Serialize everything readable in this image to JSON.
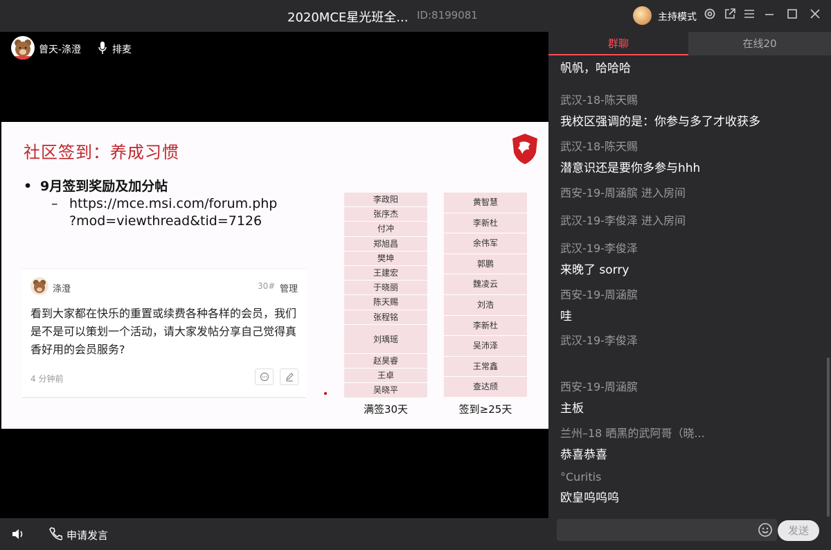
{
  "titlebar": {
    "title": "2020MCE星光班全...",
    "room_id": "ID:8199081",
    "host_mode": "主持模式"
  },
  "video": {
    "user_name": "曾天-涤澄",
    "queue_label": "排麦"
  },
  "slide": {
    "title": "社区签到：养成习惯",
    "bullet": "9月签到奖励及加分帖",
    "link_line1": "https://mce.msi.com/forum.php",
    "link_line2": "?mod=viewthread&tid=7126",
    "post": {
      "name": "涤澄",
      "floor": "30#",
      "admin": "管理",
      "body": "看到大家都在快乐的重置或续费各种各样的会员，我们是不是可以策划一个活动，请大家发帖分享自己觉得真香好用的会员服务?",
      "time": "4 分钟前"
    },
    "table1": {
      "label": "满签30天",
      "names": [
        "李政阳",
        "张序杰",
        "付冲",
        "郑旭昌",
        "樊坤",
        "王建宏",
        "于晓丽",
        "陈天赐",
        "张程铭",
        "刘瑀瑶",
        "赵昊睿",
        "王卓",
        "吴晓平"
      ]
    },
    "table2": {
      "label": "签到≥25天",
      "names": [
        "黄智慧",
        "李新杜",
        "余伟军",
        "郭鹏",
        "魏凌云",
        "刘浩",
        "李新杜",
        "吴沛泽",
        "王常鑫",
        "查达颀"
      ]
    }
  },
  "bottombar": {
    "apply_label": "申请发言"
  },
  "chat": {
    "tab_group": "群聊",
    "tab_online": "在线20",
    "messages": [
      {
        "sender": "",
        "text": "帆帆，哈哈哈"
      },
      {
        "sender": "武汉-18-陈天赐",
        "text": "我校区强调的是：你参与多了才收获多"
      },
      {
        "sender": "武汉-18-陈天赐",
        "text": "潜意识还是要你多参与hhh"
      },
      {
        "sender": "西安-19-周涵膑 进入房间",
        "text": ""
      },
      {
        "sender": "武汉-19-李俊泽 进入房间",
        "text": ""
      },
      {
        "sender": "武汉-19-李俊泽",
        "text": "来晚了 sorry"
      },
      {
        "sender": "西安-19-周涵膑",
        "text": "哇"
      },
      {
        "sender": "武汉-19-李俊泽",
        "text": ""
      },
      {
        "sender": "西安-19-周涵膑",
        "text": "主板"
      },
      {
        "sender": "兰州–18 晒黑的武阿哥（晓...",
        "text": "恭喜恭喜"
      },
      {
        "sender": "°Curitis",
        "text": "欧皇呜呜呜"
      }
    ],
    "send_label": "发送"
  }
}
